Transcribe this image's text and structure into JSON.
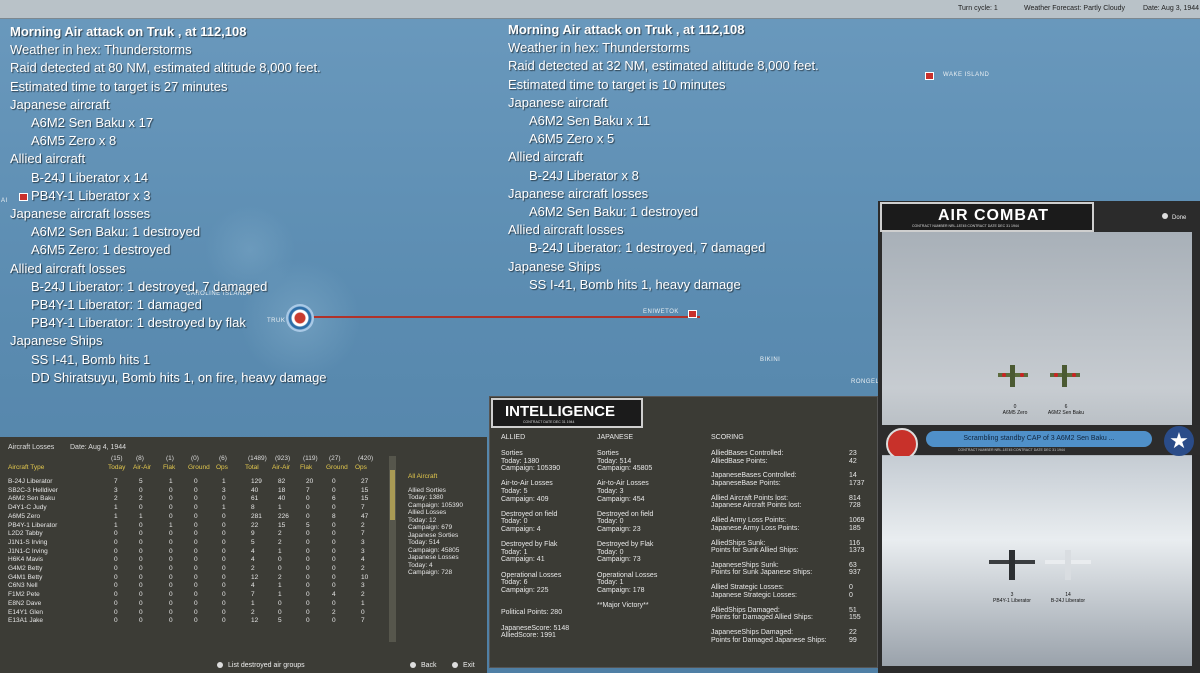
{
  "topbar": {
    "turn": "Turn cycle: 1",
    "weather": "Weather Forecast: Partly Cloudy",
    "date": "Date: Aug 3, 1944"
  },
  "report1": {
    "lines": [
      {
        "t": "Morning Air attack on Truk , at 112,108",
        "c": "title"
      },
      {
        "t": "Weather in hex: Thunderstorms",
        "c": ""
      },
      {
        "t": "Raid detected at 80 NM, estimated altitude 8,000 feet.",
        "c": ""
      },
      {
        "t": "Estimated time to target is 27 minutes",
        "c": ""
      },
      {
        "t": "Japanese aircraft",
        "c": ""
      },
      {
        "t": "A6M2 Sen Baku x 17",
        "c": "ind"
      },
      {
        "t": "A6M5 Zero x 8",
        "c": "ind"
      },
      {
        "t": "Allied aircraft",
        "c": ""
      },
      {
        "t": "B-24J Liberator x 14",
        "c": "ind"
      },
      {
        "t": "PB4Y-1 Liberator x 3",
        "c": "ind"
      },
      {
        "t": "Japanese aircraft losses",
        "c": ""
      },
      {
        "t": "A6M2 Sen Baku: 1 destroyed",
        "c": "ind"
      },
      {
        "t": "A6M5 Zero: 1 destroyed",
        "c": "ind"
      },
      {
        "t": "Allied aircraft losses",
        "c": ""
      },
      {
        "t": "B-24J Liberator: 1 destroyed, 7 damaged",
        "c": "ind"
      },
      {
        "t": "PB4Y-1 Liberator: 1 damaged",
        "c": "ind"
      },
      {
        "t": "PB4Y-1 Liberator: 1 destroyed by flak",
        "c": "ind"
      },
      {
        "t": "Japanese Ships",
        "c": ""
      },
      {
        "t": "SS I-41, Bomb hits 1",
        "c": "ind"
      },
      {
        "t": "DD Shiratsuyu, Bomb hits 1,  on fire,  heavy damage",
        "c": "ind"
      }
    ]
  },
  "report2": {
    "lines": [
      {
        "t": "Morning Air attack on Truk , at 112,108",
        "c": "title"
      },
      {
        "t": "Weather in hex: Thunderstorms",
        "c": ""
      },
      {
        "t": "Raid detected at 32 NM, estimated altitude 8,000 feet.",
        "c": ""
      },
      {
        "t": "Estimated time to target is 10 minutes",
        "c": ""
      },
      {
        "t": "Japanese aircraft",
        "c": ""
      },
      {
        "t": "A6M2 Sen Baku x 11",
        "c": "ind"
      },
      {
        "t": "A6M5 Zero x 5",
        "c": "ind"
      },
      {
        "t": "Allied aircraft",
        "c": ""
      },
      {
        "t": "B-24J Liberator x 8",
        "c": "ind"
      },
      {
        "t": "Japanese aircraft losses",
        "c": ""
      },
      {
        "t": "A6M2 Sen Baku: 1 destroyed",
        "c": "ind"
      },
      {
        "t": "Allied aircraft losses",
        "c": ""
      },
      {
        "t": "B-24J Liberator: 1 destroyed, 7 damaged",
        "c": "ind"
      },
      {
        "t": "Japanese Ships",
        "c": ""
      },
      {
        "t": "SS I-41, Bomb hits 1,  heavy damage",
        "c": "ind"
      }
    ]
  },
  "map": {
    "truk": "TRUK",
    "caroline": "CAROLINE ISLANDS",
    "eniwetok": "ENIWETOK",
    "bikini": "BIKINI",
    "wake": "WAKE ISLAND",
    "rongela": "RONGELA",
    "ai": "AI"
  },
  "losses": {
    "title": "Aircraft Losses",
    "date": "Date: Aug 4, 1944",
    "group_counts": [
      "(15)",
      "(8)",
      "(1)",
      "(0)",
      "(6)",
      "(1489)",
      "(923)",
      "(119)",
      "(27)",
      "(420)"
    ],
    "headers": [
      "Aircraft Type",
      "Today",
      "Air-Air",
      "Flak",
      "Ground",
      "Ops",
      "Total",
      "Air-Air",
      "Flak",
      "Ground",
      "Ops"
    ],
    "rows": [
      [
        "B-24J Liberator",
        "7",
        "5",
        "1",
        "0",
        "1",
        "129",
        "82",
        "20",
        "0",
        "27"
      ],
      [
        "SB2C-3 Helldiver",
        "3",
        "0",
        "0",
        "0",
        "3",
        "40",
        "18",
        "7",
        "0",
        "15"
      ],
      [
        "A6M2 Sen Baku",
        "2",
        "2",
        "0",
        "0",
        "0",
        "61",
        "40",
        "0",
        "6",
        "15"
      ],
      [
        "D4Y1-C Judy",
        "1",
        "0",
        "0",
        "0",
        "1",
        "8",
        "1",
        "0",
        "0",
        "7"
      ],
      [
        "A6M5 Zero",
        "1",
        "1",
        "0",
        "0",
        "0",
        "281",
        "226",
        "0",
        "8",
        "47"
      ],
      [
        "PB4Y-1 Liberator",
        "1",
        "0",
        "1",
        "0",
        "0",
        "22",
        "15",
        "5",
        "0",
        "2"
      ],
      [
        "L2D2 Tabby",
        "0",
        "0",
        "0",
        "0",
        "0",
        "9",
        "2",
        "0",
        "0",
        "7"
      ],
      [
        "J1N1-S Irving",
        "0",
        "0",
        "0",
        "0",
        "0",
        "5",
        "2",
        "0",
        "0",
        "3"
      ],
      [
        "J1N1-C Irving",
        "0",
        "0",
        "0",
        "0",
        "0",
        "4",
        "1",
        "0",
        "0",
        "3"
      ],
      [
        "H6K4 Mavis",
        "0",
        "0",
        "0",
        "0",
        "0",
        "4",
        "0",
        "0",
        "0",
        "4"
      ],
      [
        "G4M2 Betty",
        "0",
        "0",
        "0",
        "0",
        "0",
        "2",
        "0",
        "0",
        "0",
        "2"
      ],
      [
        "G4M1 Betty",
        "0",
        "0",
        "0",
        "0",
        "0",
        "12",
        "2",
        "0",
        "0",
        "10"
      ],
      [
        "C6N3 Nell",
        "0",
        "0",
        "0",
        "0",
        "0",
        "4",
        "1",
        "0",
        "0",
        "3"
      ],
      [
        "F1M2 Pete",
        "0",
        "0",
        "0",
        "0",
        "0",
        "7",
        "1",
        "0",
        "4",
        "2"
      ],
      [
        "E8N2 Dave",
        "0",
        "0",
        "0",
        "0",
        "0",
        "1",
        "0",
        "0",
        "0",
        "1"
      ],
      [
        "E14Y1 Glen",
        "0",
        "0",
        "0",
        "0",
        "0",
        "2",
        "0",
        "0",
        "2",
        "0"
      ],
      [
        "E13A1 Jake",
        "0",
        "0",
        "0",
        "0",
        "0",
        "12",
        "5",
        "0",
        "0",
        "7"
      ]
    ],
    "side": [
      "All Aircraft",
      "Allied Sorties",
      "Today:    1380",
      "Campaign: 105390",
      "Allied Losses",
      "Today:   12",
      "Campaign: 679",
      "Japanese Sorties",
      "Today:    514",
      "Campaign: 45805",
      "Japanese Losses",
      "Today:    4",
      "Campaign: 728"
    ],
    "list_btn": "List destroyed air groups",
    "back": "Back",
    "exit": "Exit"
  },
  "intel": {
    "banner": "INTELLIGENCE",
    "banner_sub": "CONTRACT DATE  DEC  31  1944",
    "allied_h": "ALLIED",
    "japanese_h": "JAPANESE",
    "scoring_h": "SCORING",
    "allied": [
      "Sorties",
      "Today:     1380",
      "Campaign: 105390",
      "",
      "Air-to-Air Losses",
      "Today:     5",
      "Campaign: 409",
      "",
      "Destroyed on field",
      "Today:     0",
      "Campaign: 4",
      "",
      "Destroyed by Flak",
      "Today:     1",
      "Campaign: 41",
      "",
      "Operational Losses",
      "Today:     6",
      "Campaign: 225",
      "",
      "",
      "Political Points: 280",
      "",
      "JapaneseScore: 5148",
      "AlliedScore: 1991"
    ],
    "japanese": [
      "Sorties",
      "Today:     514",
      "Campaign: 45805",
      "",
      "Air-to-Air Losses",
      "Today:     3",
      "Campaign: 454",
      "",
      "Destroyed on field",
      "Today:     0",
      "Campaign: 23",
      "",
      "Destroyed by Flak",
      "Today:     0",
      "Campaign: 73",
      "",
      "Operational Losses",
      "Today:     1",
      "Campaign: 178",
      "",
      "**Major Victory**"
    ],
    "scoring": [
      [
        "AlliedBases Controlled:",
        "23"
      ],
      [
        "AlliedBase Points:",
        "42"
      ],
      [
        "",
        ""
      ],
      [
        "JapaneseBases Controlled:",
        "14"
      ],
      [
        "JapaneseBase Points:",
        "1737"
      ],
      [
        "",
        ""
      ],
      [
        "Allied Aircraft Points lost:",
        "814"
      ],
      [
        "Japanese Aircraft Points lost:",
        "728"
      ],
      [
        "",
        ""
      ],
      [
        "Allied Army Loss Points:",
        "1069"
      ],
      [
        "Japanese Army Loss Points:",
        "185"
      ],
      [
        "",
        ""
      ],
      [
        "AlliedShips Sunk:",
        "116"
      ],
      [
        "Points for Sunk Allied Ships:",
        "1373"
      ],
      [
        "",
        ""
      ],
      [
        "JapaneseShips Sunk:",
        "63"
      ],
      [
        "Points for Sunk Japanese Ships:",
        "937"
      ],
      [
        "",
        ""
      ],
      [
        "Allied Strategic Losses:",
        "0"
      ],
      [
        "Japanese Strategic Losses:",
        "0"
      ],
      [
        "",
        ""
      ],
      [
        "AlliedShips Damaged:",
        "51"
      ],
      [
        "Points for Damaged Allied Ships:",
        "155"
      ],
      [
        "",
        ""
      ],
      [
        "JapaneseShips Damaged:",
        "22"
      ],
      [
        "Points for Damaged Japanese Ships:",
        "99"
      ]
    ]
  },
  "combat": {
    "banner": "AIR COMBAT",
    "banner_sub": "CONTRACT NUMBER  NRL-18745      CONTRACT DATE  DEC  31  1944",
    "done": "Done",
    "top_planes": [
      {
        "count": "0",
        "name": "A6M5 Zero"
      },
      {
        "count": "6",
        "name": "A6M2 Sen Baku"
      }
    ],
    "scramble": "Scrambling standby CAP of 3 A6M2 Sen Baku ...",
    "scram_sub": "CONTRACT NUMBER  NRL-18745      CONTRACT DATE  DEC  31  1944",
    "bottom_planes": [
      {
        "count": "3",
        "name": "PB4Y-1 Liberator"
      },
      {
        "count": "14",
        "name": "B-24J Liberator"
      }
    ]
  }
}
